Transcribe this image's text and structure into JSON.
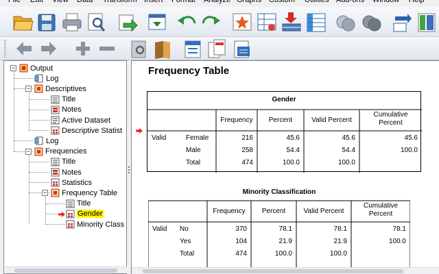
{
  "menu": [
    "File",
    "Edit",
    "View",
    "Data",
    "Transform",
    "Insert",
    "Format",
    "Analyze",
    "Graphs",
    "Custom",
    "Utilities",
    "Add-ons",
    "Window",
    "Help"
  ],
  "toolbar_icons": [
    "open-folder-icon",
    "save-icon",
    "print-icon",
    "print-preview-icon",
    "export-icon",
    "recall-dialog-icon",
    "undo-icon",
    "redo-icon",
    "goto-case-icon",
    "goto-variable-icon",
    "insert-cases-icon",
    "variables-icon",
    "use-sets-icon",
    "show-all-icon",
    "designate-window-icon",
    "split-icon"
  ],
  "toolbar2_icons": [
    "promote-icon",
    "demote-icon",
    "expand-icon",
    "collapse-icon",
    "show-icon",
    "hide-icon",
    "insert-heading-icon",
    "insert-title-icon",
    "insert-text-icon",
    "insert-image-icon"
  ],
  "tree": [
    {
      "label": "Output",
      "icon": "output-book-icon",
      "level": 0,
      "expander": "minus"
    },
    {
      "label": "Log",
      "icon": "log-icon",
      "level": 1
    },
    {
      "label": "Descriptives",
      "icon": "book-icon",
      "level": 1,
      "expander": "minus"
    },
    {
      "label": "Title",
      "icon": "title-icon",
      "level": 2
    },
    {
      "label": "Notes",
      "icon": "notes-icon",
      "level": 2
    },
    {
      "label": "Active Dataset",
      "icon": "dataset-icon",
      "level": 2
    },
    {
      "label": "Descriptive Statist",
      "icon": "table-icon",
      "level": 2
    },
    {
      "label": "Log",
      "icon": "log-icon",
      "level": 1
    },
    {
      "label": "Frequencies",
      "icon": "book-icon",
      "level": 1,
      "expander": "minus"
    },
    {
      "label": "Title",
      "icon": "title-icon",
      "level": 2
    },
    {
      "label": "Notes",
      "icon": "notes-icon",
      "level": 2
    },
    {
      "label": "Statistics",
      "icon": "table-icon",
      "level": 2
    },
    {
      "label": "Frequency Table",
      "icon": "book-icon",
      "level": 2,
      "expander": "minus"
    },
    {
      "label": "Title",
      "icon": "title-icon",
      "level": 3
    },
    {
      "label": "Gender",
      "icon": "table-icon",
      "level": 3,
      "selected": true
    },
    {
      "label": "Minority Class",
      "icon": "table-icon",
      "level": 3
    }
  ],
  "heading": "Frequency Table",
  "tables": [
    {
      "caption": "Gender",
      "headers": [
        "Frequency",
        "Percent",
        "Valid Percent",
        "Cumulative Percent"
      ],
      "group": "Valid",
      "rows": [
        {
          "label": "Female",
          "frequency": "216",
          "percent": "45.6",
          "valid_percent": "45.6",
          "cumulative": "45.6"
        },
        {
          "label": "Male",
          "frequency": "258",
          "percent": "54.4",
          "valid_percent": "54.4",
          "cumulative": "100.0"
        },
        {
          "label": "Total",
          "frequency": "474",
          "percent": "100.0",
          "valid_percent": "100.0",
          "cumulative": ""
        }
      ]
    },
    {
      "caption": "Minority Classification",
      "headers": [
        "Frequency",
        "Percent",
        "Valid Percent",
        "Cumulative Percent"
      ],
      "group": "Valid",
      "rows": [
        {
          "label": "No",
          "frequency": "370",
          "percent": "78.1",
          "valid_percent": "78.1",
          "cumulative": "78.1"
        },
        {
          "label": "Yes",
          "frequency": "104",
          "percent": "21.9",
          "valid_percent": "21.9",
          "cumulative": "100.0"
        },
        {
          "label": "Total",
          "frequency": "474",
          "percent": "100.0",
          "valid_percent": "100.0",
          "cumulative": ""
        }
      ]
    }
  ],
  "colors": {
    "selected_highlight": "#fff200",
    "marker_arrow": "#e8201c"
  }
}
